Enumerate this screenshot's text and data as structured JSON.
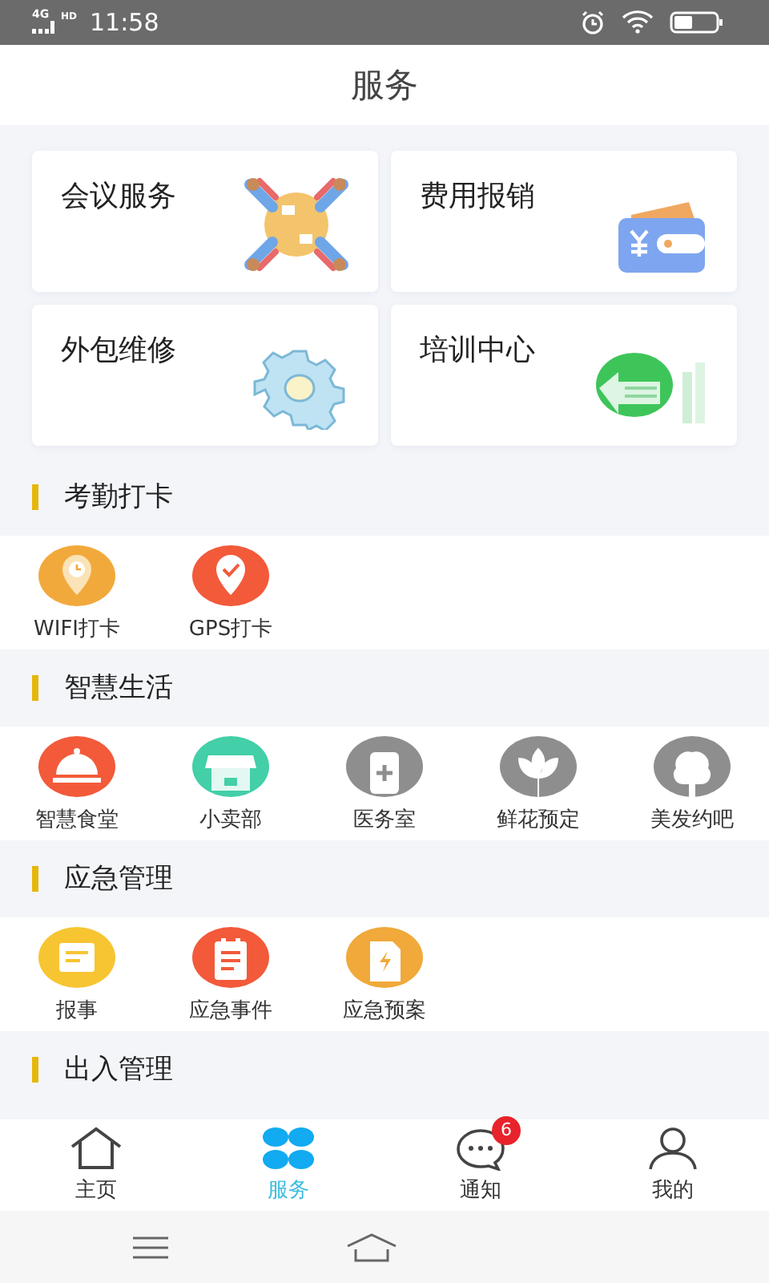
{
  "status_bar": {
    "network": "4G",
    "hd": "HD",
    "time": "11:58"
  },
  "header": {
    "title": "服务"
  },
  "cards": [
    {
      "title": "会议服务",
      "kind": "meeting"
    },
    {
      "title": "费用报销",
      "kind": "wallet"
    },
    {
      "title": "外包维修",
      "kind": "gear"
    },
    {
      "title": "培训中心",
      "kind": "training"
    }
  ],
  "sections": [
    {
      "title": "考勤打卡",
      "items": [
        {
          "label": "WIFI打卡",
          "kind": "pin-clock",
          "disabled": false
        },
        {
          "label": "GPS打卡",
          "kind": "pin-check",
          "disabled": false
        }
      ]
    },
    {
      "title": "智慧生活",
      "items": [
        {
          "label": "智慧食堂",
          "kind": "cloche",
          "disabled": false
        },
        {
          "label": "小卖部",
          "kind": "shop",
          "disabled": false
        },
        {
          "label": "医务室",
          "kind": "medicine",
          "disabled": true
        },
        {
          "label": "鲜花预定",
          "kind": "flower",
          "disabled": true
        },
        {
          "label": "美发约吧",
          "kind": "tree",
          "disabled": true
        }
      ]
    },
    {
      "title": "应急管理",
      "items": [
        {
          "label": "报事",
          "kind": "note",
          "disabled": false
        },
        {
          "label": "应急事件",
          "kind": "clipboard",
          "disabled": false
        },
        {
          "label": "应急预案",
          "kind": "file",
          "disabled": false
        }
      ]
    },
    {
      "title": "出入管理"
    }
  ],
  "tabs": [
    {
      "label": "主页",
      "kind": "home",
      "selected": false
    },
    {
      "label": "服务",
      "kind": "grid",
      "selected": true
    },
    {
      "label": "通知",
      "kind": "chat",
      "selected": false,
      "badge": "6"
    },
    {
      "label": "我的",
      "kind": "person",
      "selected": false
    }
  ]
}
